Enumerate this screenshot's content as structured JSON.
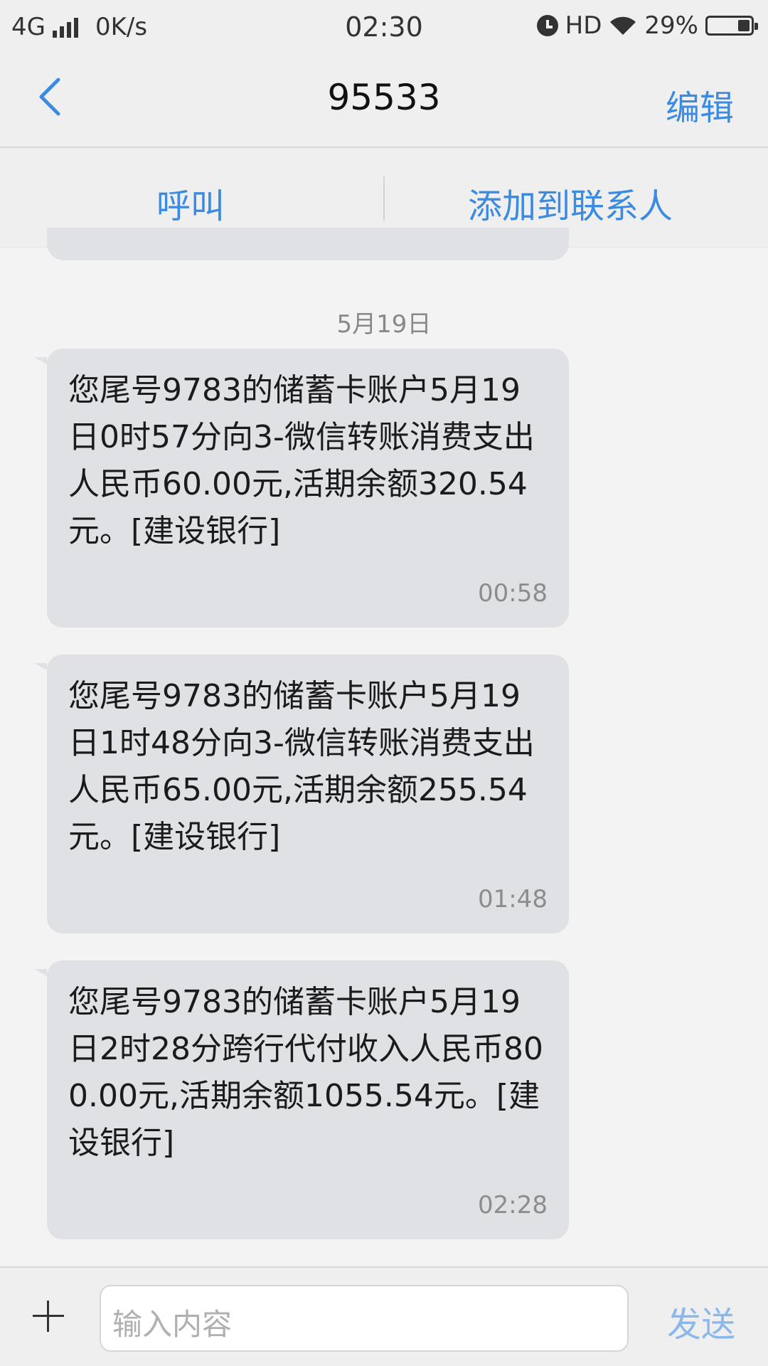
{
  "status_bar": {
    "network": "4G",
    "speed": "0K/s",
    "time": "02:30",
    "hd": "HD",
    "battery": "29%",
    "battery_level": 0.29
  },
  "header": {
    "title": "95533",
    "edit_label": "编辑"
  },
  "actions": {
    "call_label": "呼叫",
    "add_contact_label": "添加到联系人"
  },
  "date_divider": "5月19日",
  "messages": [
    {
      "text": "您尾号9783的储蓄卡账户5月19日0时57分向3-微信转账消费支出人民币60.00元,活期余额320.54元。[建设银行]",
      "time": "00:58"
    },
    {
      "text": "您尾号9783的储蓄卡账户5月19日1时48分向3-微信转账消费支出人民币65.00元,活期余额255.54元。[建设银行]",
      "time": "01:48"
    },
    {
      "text": "您尾号9783的储蓄卡账户5月19日2时28分跨行代付收入人民币800.00元,活期余额1055.54元。[建设银行]",
      "time": "02:28"
    }
  ],
  "composer": {
    "placeholder": "输入内容",
    "send_label": "发送"
  },
  "colors": {
    "accent": "#3b8be0",
    "send_disabled": "#8ab8ea",
    "bubble": "#dfe1e4",
    "background": "#f3f3f3"
  }
}
